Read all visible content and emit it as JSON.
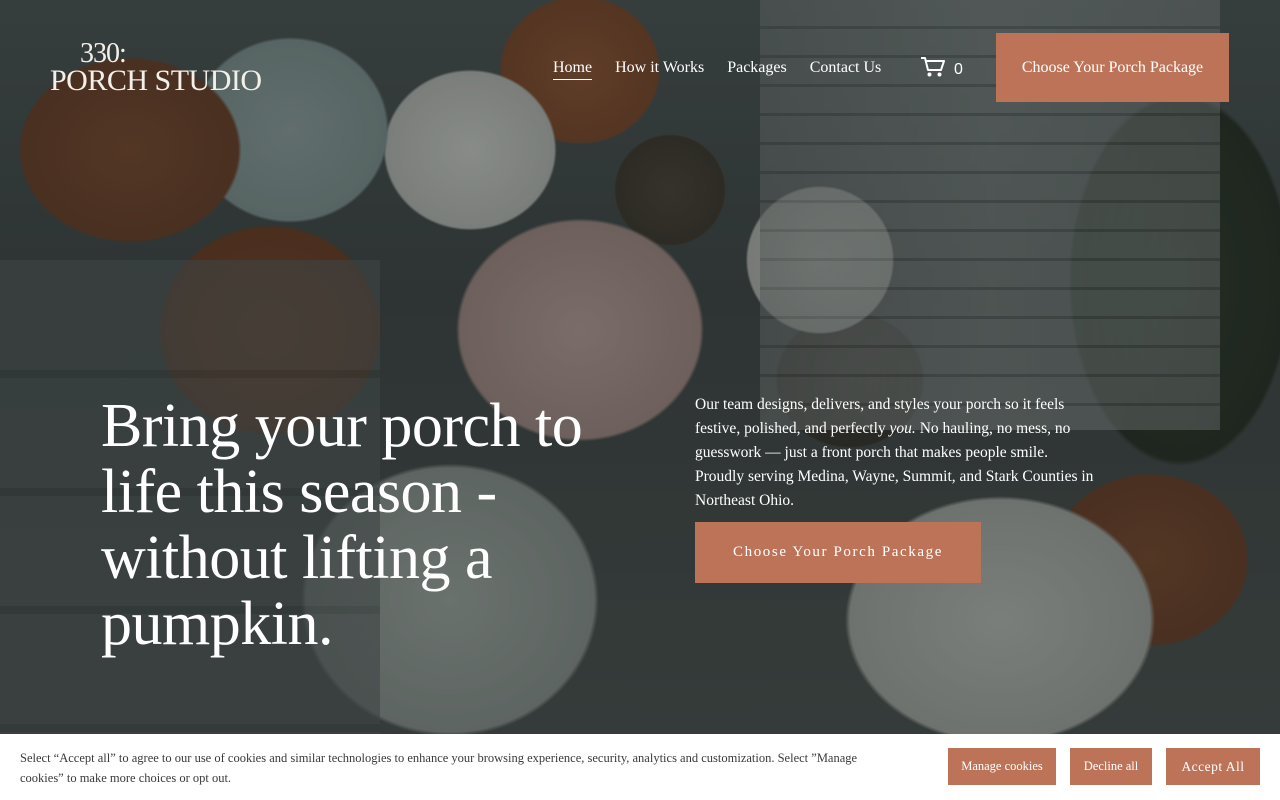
{
  "brand": {
    "logo_number": "330:",
    "logo_name": "PORCH STUDIO"
  },
  "nav": {
    "items": [
      {
        "label": "Home",
        "active": true
      },
      {
        "label": "How it Works",
        "active": false
      },
      {
        "label": "Packages",
        "active": false
      },
      {
        "label": "Contact Us",
        "active": false
      }
    ]
  },
  "cart": {
    "icon": "cart-icon",
    "count": "0"
  },
  "header": {
    "cta_label": "Choose Your Porch Package"
  },
  "hero": {
    "headline": "Bring your porch to life this season - without lifting a pumpkin.",
    "description_part1": "Our team designs, delivers, and styles your porch so it feels festive, polished, and perfectly ",
    "description_emphasis": "you.",
    "description_part2": " No hauling, no mess, no guesswork — just a front porch that makes people smile. Proudly serving Medina, Wayne, Summit, and Stark Counties in Northeast Ohio.",
    "cta_label": "Choose Your Porch Package"
  },
  "cookie_banner": {
    "text": "Select “Accept all” to agree to our use of cookies and similar technologies to enhance your browsing experience, security, analytics and customization. Select ”Manage cookies” to make more choices or opt out.",
    "manage_label": "Manage cookies",
    "decline_label": "Decline all",
    "accept_label": "Accept All"
  },
  "colors": {
    "accent": "#bd7358",
    "text_light": "#ffffff",
    "banner_bg": "#ffffff"
  }
}
